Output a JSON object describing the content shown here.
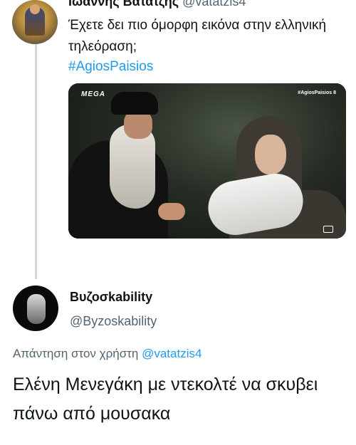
{
  "tweet1": {
    "display_name": "Ιωαννης Βατατζης",
    "handle": "@vatatzis4",
    "text": "Έχετε δει πιο όμορφη εικόνα στην ελληνική τηλεόραση;",
    "hashtag": "#AgiosPaisios",
    "media": {
      "channel_logo": "ΜΕGΑ",
      "overlay_tag": "#AgiosPaisios 8"
    }
  },
  "tweet2": {
    "display_name": "Βυζοσkability",
    "handle": "@Byzoskability",
    "reply_prefix": "Απάντηση στον χρήστη",
    "reply_to": "@vatatzis4",
    "text": "Ελένη Μενεγάκη με ντεκολτέ να σκυβει πάνω από μουσακα"
  },
  "colors": {
    "link": "#1d9bf0",
    "secondary_text": "#536471",
    "thread_line": "#cfd9de"
  }
}
